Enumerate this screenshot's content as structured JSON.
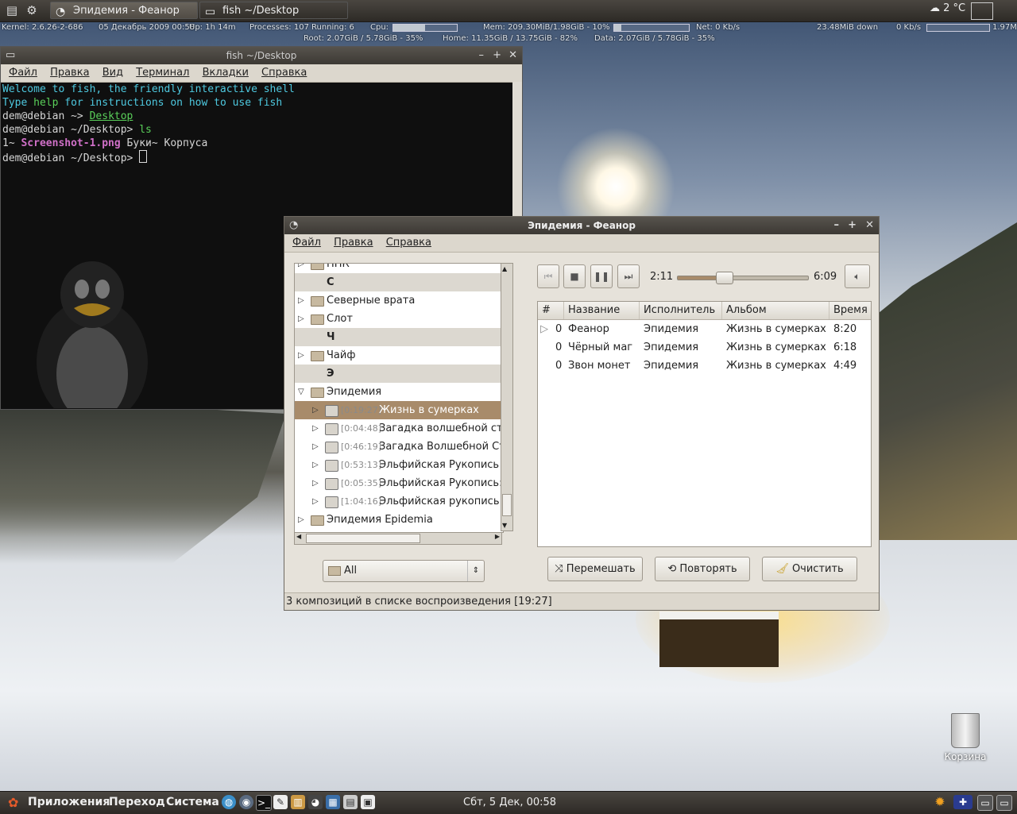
{
  "top_panel": {
    "tasks": [
      {
        "label": "Эпидемия - Феанор",
        "active": true
      },
      {
        "label": "fish  ~/Desktop",
        "active": false
      }
    ],
    "weather": "2 °C"
  },
  "conky": {
    "kernel": "Kernel: 2.6.26-2-686",
    "date": "05 Декабрь 2009 00:58",
    "uptime": "Up: 1h 14m",
    "processes": "Processes: 107",
    "running": "Running: 6",
    "cpu_label": "Cpu:",
    "cpu_fraction": 0.5,
    "mem": "Mem: 209.30MiB/1.98GiB - 10%",
    "mem_fraction": 0.1,
    "net": "Net: 0 Kb/s",
    "down": "23.48MiB down",
    "up_rate": "0 Kb/s",
    "total": "1.97M",
    "root": "Root: 2.07GiB  / 5.78GiB - 35%",
    "home": "Home: 11.35GiB  / 13.75GiB - 82%",
    "data": "Data: 2.07GiB  / 5.78GiB - 35%"
  },
  "terminal": {
    "title": "fish  ~/Desktop",
    "menu": [
      "Файл",
      "Правка",
      "Вид",
      "Терминал",
      "Вкладки",
      "Справка"
    ],
    "lines": {
      "welcome": "Welcome to fish, the friendly interactive shell",
      "type_pre": "Type ",
      "type_help": "help",
      "type_post": " for instructions on how to use fish",
      "prompt_user": "dem@debian",
      "prompt_home": " ~> ",
      "cmd_desktop": "Desktop",
      "prompt_desktop": " ~/Desktop> ",
      "cmd_ls": "ls",
      "ls_1": "1~",
      "ls_2": "Screenshot-1.png",
      "ls_3": "Буки~",
      "ls_4": "Корпуса"
    }
  },
  "player": {
    "title": "Эпидемия - Феанор",
    "menu": [
      "Файл",
      "Правка",
      "Справка"
    ],
    "tree": [
      {
        "type": "folder",
        "label": "ППК",
        "level": 0
      },
      {
        "type": "header",
        "label": "С"
      },
      {
        "type": "folder",
        "label": "Северные врата",
        "level": 0
      },
      {
        "type": "folder",
        "label": "Слот",
        "level": 0
      },
      {
        "type": "header",
        "label": "Ч"
      },
      {
        "type": "folder",
        "label": "Чайф",
        "level": 0
      },
      {
        "type": "header",
        "label": "Э"
      },
      {
        "type": "folder",
        "label": "Эпидемия",
        "level": 0,
        "expanded": true
      },
      {
        "type": "album",
        "dur": "[0:19:27]",
        "label": "Жизнь в сумерках",
        "selected": true
      },
      {
        "type": "album",
        "dur": "[0:04:48]",
        "label": "Загадка волшебной стра"
      },
      {
        "type": "album",
        "dur": "[0:46:19]",
        "label": "Загадка Волшебной Стра"
      },
      {
        "type": "album",
        "dur": "[0:53:13]",
        "label": "Эльфийская Рукопись"
      },
      {
        "type": "album",
        "dur": "[0:05:35]",
        "label": "Эльфийская Рукопись: С"
      },
      {
        "type": "album",
        "dur": "[1:04:16]",
        "label": "Эльфийская рукопись: С"
      },
      {
        "type": "folder",
        "label": "Эпидемия Epidemia",
        "level": 0
      }
    ],
    "filter": "All",
    "time_elapsed": "2:11",
    "time_total": "6:09",
    "progress": 0.355,
    "columns": {
      "num": "#",
      "title": "Название",
      "artist": "Исполнитель",
      "album": "Альбом",
      "time": "Время"
    },
    "tracks": [
      {
        "num": "0",
        "title": "Феанор",
        "artist": "Эпидемия",
        "album": "Жизнь в сумерках",
        "time": "8:20",
        "playing": true
      },
      {
        "num": "0",
        "title": "Чёрный маг",
        "artist": "Эпидемия",
        "album": "Жизнь в сумерках",
        "time": "6:18"
      },
      {
        "num": "0",
        "title": "Звон монет",
        "artist": "Эпидемия",
        "album": "Жизнь в сумерках",
        "time": "4:49"
      }
    ],
    "buttons": {
      "shuffle": "Перемешать",
      "repeat": "Повторять",
      "clear": "Очистить"
    },
    "status": "3 композиций в списке воспроизведения  [19:27]"
  },
  "desktop": {
    "trash_label": "Корзина"
  },
  "bottom_panel": {
    "menus": [
      "Приложения",
      "Переход",
      "Система"
    ],
    "clock": "Сбт,  5 Дек, 00:58"
  }
}
